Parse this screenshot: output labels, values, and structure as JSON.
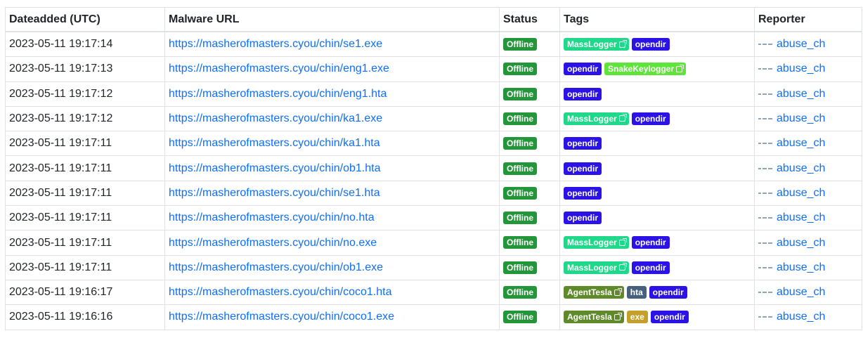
{
  "table": {
    "headers": [
      "Dateadded (UTC)",
      "Malware URL",
      "Status",
      "Tags",
      "Reporter"
    ],
    "rows": [
      {
        "date": "2023-05-11 19:17:14",
        "url": "https://masherofmasters.cyou/chin/se1.exe",
        "status": "Offline",
        "tags": [
          {
            "label": "MassLogger",
            "color": "#20d88a",
            "ext": true
          },
          {
            "label": "opendir",
            "color": "#2b12e6",
            "ext": false
          }
        ],
        "reporter": "abuse_ch"
      },
      {
        "date": "2023-05-11 19:17:13",
        "url": "https://masherofmasters.cyou/chin/eng1.exe",
        "status": "Offline",
        "tags": [
          {
            "label": "opendir",
            "color": "#2b12e6",
            "ext": false
          },
          {
            "label": "SnakeKeylogger",
            "color": "#5fe43a",
            "ext": true
          }
        ],
        "reporter": "abuse_ch"
      },
      {
        "date": "2023-05-11 19:17:12",
        "url": "https://masherofmasters.cyou/chin/eng1.hta",
        "status": "Offline",
        "tags": [
          {
            "label": "opendir",
            "color": "#2b12e6",
            "ext": false
          }
        ],
        "reporter": "abuse_ch"
      },
      {
        "date": "2023-05-11 19:17:12",
        "url": "https://masherofmasters.cyou/chin/ka1.exe",
        "status": "Offline",
        "tags": [
          {
            "label": "MassLogger",
            "color": "#20d88a",
            "ext": true
          },
          {
            "label": "opendir",
            "color": "#2b12e6",
            "ext": false
          }
        ],
        "reporter": "abuse_ch"
      },
      {
        "date": "2023-05-11 19:17:11",
        "url": "https://masherofmasters.cyou/chin/ka1.hta",
        "status": "Offline",
        "tags": [
          {
            "label": "opendir",
            "color": "#2b12e6",
            "ext": false
          }
        ],
        "reporter": "abuse_ch"
      },
      {
        "date": "2023-05-11 19:17:11",
        "url": "https://masherofmasters.cyou/chin/ob1.hta",
        "status": "Offline",
        "tags": [
          {
            "label": "opendir",
            "color": "#2b12e6",
            "ext": false
          }
        ],
        "reporter": "abuse_ch"
      },
      {
        "date": "2023-05-11 19:17:11",
        "url": "https://masherofmasters.cyou/chin/se1.hta",
        "status": "Offline",
        "tags": [
          {
            "label": "opendir",
            "color": "#2b12e6",
            "ext": false
          }
        ],
        "reporter": "abuse_ch"
      },
      {
        "date": "2023-05-11 19:17:11",
        "url": "https://masherofmasters.cyou/chin/no.hta",
        "status": "Offline",
        "tags": [
          {
            "label": "opendir",
            "color": "#2b12e6",
            "ext": false
          }
        ],
        "reporter": "abuse_ch"
      },
      {
        "date": "2023-05-11 19:17:11",
        "url": "https://masherofmasters.cyou/chin/no.exe",
        "status": "Offline",
        "tags": [
          {
            "label": "MassLogger",
            "color": "#20d88a",
            "ext": true
          },
          {
            "label": "opendir",
            "color": "#2b12e6",
            "ext": false
          }
        ],
        "reporter": "abuse_ch"
      },
      {
        "date": "2023-05-11 19:17:11",
        "url": "https://masherofmasters.cyou/chin/ob1.exe",
        "status": "Offline",
        "tags": [
          {
            "label": "MassLogger",
            "color": "#20d88a",
            "ext": true
          },
          {
            "label": "opendir",
            "color": "#2b12e6",
            "ext": false
          }
        ],
        "reporter": "abuse_ch"
      },
      {
        "date": "2023-05-11 19:16:17",
        "url": "https://masherofmasters.cyou/chin/coco1.hta",
        "status": "Offline",
        "tags": [
          {
            "label": "AgentTesla",
            "color": "#5e8a2a",
            "ext": true
          },
          {
            "label": "hta",
            "color": "#46607d",
            "ext": false
          },
          {
            "label": "opendir",
            "color": "#2b12e6",
            "ext": false
          }
        ],
        "reporter": "abuse_ch"
      },
      {
        "date": "2023-05-11 19:16:16",
        "url": "https://masherofmasters.cyou/chin/coco1.exe",
        "status": "Offline",
        "tags": [
          {
            "label": "AgentTesla",
            "color": "#5e8a2a",
            "ext": true
          },
          {
            "label": "exe",
            "color": "#c4a02a",
            "ext": false
          },
          {
            "label": "opendir",
            "color": "#2b12e6",
            "ext": false
          }
        ],
        "reporter": "abuse_ch"
      }
    ]
  },
  "colors": {
    "status_offline": "#23963a",
    "link": "#0d6efd"
  },
  "icons": {
    "tag_external": "external-link-icon",
    "reporter_logo": "abuse-ch-logo-icon"
  }
}
